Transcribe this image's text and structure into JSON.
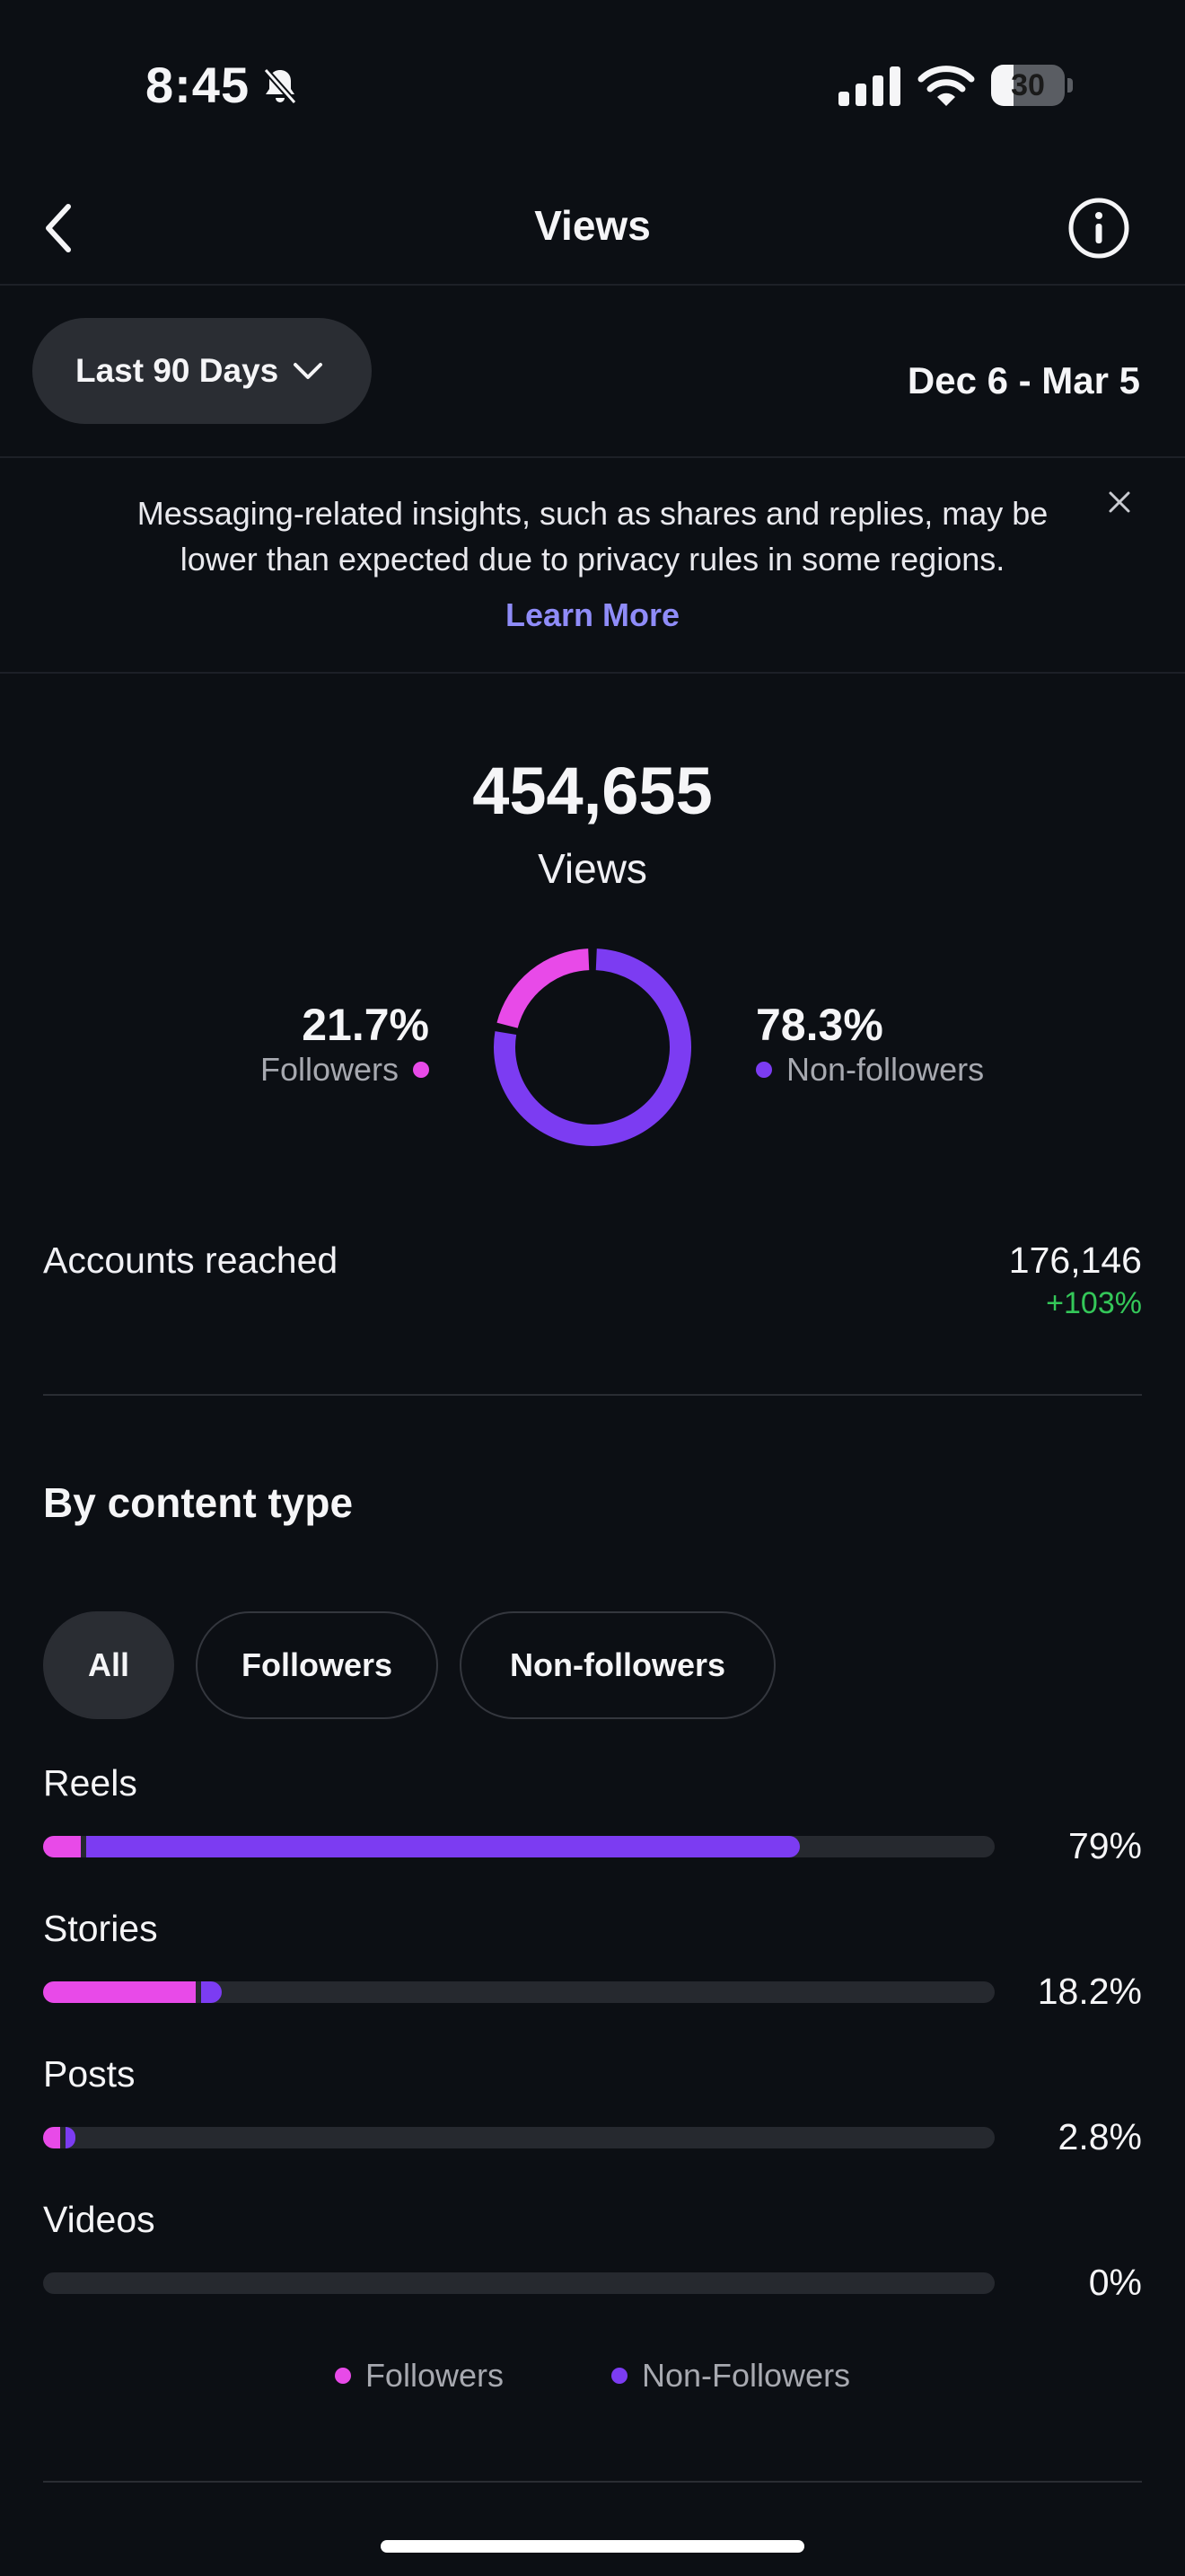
{
  "status_bar": {
    "time": "8:45",
    "battery": "30",
    "battery_level": 0.3
  },
  "header": {
    "title": "Views"
  },
  "filters": {
    "range_label": "Last 90 Days",
    "date_range": "Dec 6 - Mar 5"
  },
  "notice": {
    "text": "Messaging-related insights, such as shares and replies, may be lower than expected due to privacy rules in some regions.",
    "link": "Learn More"
  },
  "summary": {
    "total_views": "454,655",
    "views_label": "Views",
    "followers_pct": "21.7%",
    "followers_label": "Followers",
    "nonfollowers_pct": "78.3%",
    "nonfollowers_label": "Non-followers",
    "followers_share": 0.217,
    "nonfollowers_share": 0.783
  },
  "accounts": {
    "label": "Accounts reached",
    "value": "176,146",
    "change": "+103%"
  },
  "content_type": {
    "title": "By content type",
    "chips": [
      "All",
      "Followers",
      "Non-followers"
    ],
    "active_chip": "All",
    "rows": [
      {
        "label": "Reels",
        "pct": "79%",
        "followers_fraction": 0.04,
        "nonfollowers_fraction": 0.75
      },
      {
        "label": "Stories",
        "pct": "18.2%",
        "followers_fraction": 0.16,
        "nonfollowers_fraction": 0.022
      },
      {
        "label": "Posts",
        "pct": "2.8%",
        "followers_fraction": 0.018,
        "nonfollowers_fraction": 0.01
      },
      {
        "label": "Videos",
        "pct": "0%",
        "followers_fraction": 0,
        "nonfollowers_fraction": 0
      }
    ],
    "legend": {
      "followers": "Followers",
      "nonfollowers": "Non-Followers"
    }
  },
  "colors": {
    "followers": "#e84ae8",
    "nonfollowers": "#7c3cf2",
    "positive": "#34c759",
    "link": "#8f8cf8"
  },
  "icons": {
    "back": "chevron-left-icon",
    "info": "info-icon",
    "close": "close-icon",
    "dropdown": "chevron-down-icon",
    "bell": "bell-slash-icon",
    "signal": "signal-icon",
    "wifi": "wifi-icon"
  }
}
